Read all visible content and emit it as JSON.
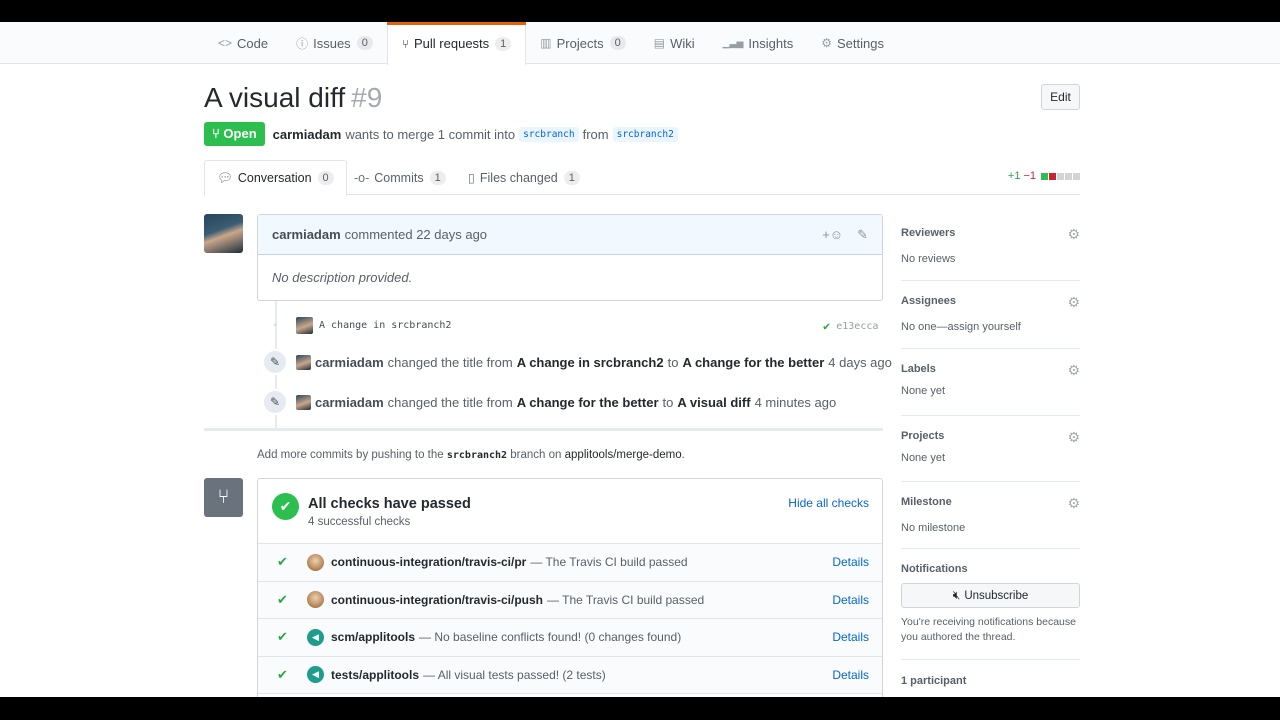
{
  "reponav": [
    {
      "icon": "code-icon",
      "glyph": "<>",
      "label": "Code",
      "count": null
    },
    {
      "icon": "issue-icon",
      "glyph": "ⓘ",
      "label": "Issues",
      "count": "0"
    },
    {
      "icon": "pull-request-icon",
      "glyph": "⑂",
      "label": "Pull requests",
      "count": "1"
    },
    {
      "icon": "project-icon",
      "glyph": "▥",
      "label": "Projects",
      "count": "0"
    },
    {
      "icon": "wiki-icon",
      "glyph": "▤",
      "label": "Wiki",
      "count": null
    },
    {
      "icon": "graph-icon",
      "glyph": "▁▃▅",
      "label": "Insights",
      "count": null
    },
    {
      "icon": "gear-icon",
      "glyph": "⚙",
      "label": "Settings",
      "count": null
    }
  ],
  "pr": {
    "title": "A visual diff",
    "number": "#9",
    "edit_label": "Edit",
    "state": "Open",
    "author": "carmiadam",
    "merge_text": "wants to merge 1 commit into",
    "base_branch": "srcbranch",
    "from_text": "from",
    "head_branch": "srcbranch2"
  },
  "tabs": [
    {
      "label": "Conversation",
      "count": "0"
    },
    {
      "label": "Commits",
      "count": "1"
    },
    {
      "label": "Files changed",
      "count": "1"
    }
  ],
  "diffstat": {
    "additions": "+1",
    "deletions": "−1"
  },
  "comment": {
    "author": "carmiadam",
    "action": "commented",
    "time": "22 days ago",
    "body": "No description provided."
  },
  "commit": {
    "message": "A change in srcbranch2",
    "sha": "e13ecca"
  },
  "events": [
    {
      "author": "carmiadam",
      "text": "changed the title from",
      "from": "A change in srcbranch2",
      "to_text": "to",
      "to": "A change for the better",
      "time": "4 days ago"
    },
    {
      "author": "carmiadam",
      "text": "changed the title from",
      "from": "A change for the better",
      "to_text": "to",
      "to": "A visual diff",
      "time": "4 minutes ago"
    }
  ],
  "push_note": {
    "prefix": "Add more commits by pushing to the",
    "branch": "srcbranch2",
    "middle": "branch on",
    "repo": "applitools/merge-demo",
    "suffix": "."
  },
  "checks": {
    "title": "All checks have passed",
    "subtitle": "4 successful checks",
    "hide_label": "Hide all checks",
    "rows": [
      {
        "name": "continuous-integration/travis-ci/pr",
        "desc": "— The Travis CI build passed",
        "details": "Details"
      },
      {
        "name": "continuous-integration/travis-ci/push",
        "desc": "— The Travis CI build passed",
        "details": "Details"
      },
      {
        "name": "scm/applitools",
        "desc": "— No baseline conflicts found! (0 changes found)",
        "details": "Details"
      },
      {
        "name": "tests/applitools",
        "desc": "— All visual tests passed! (2 tests)",
        "details": "Details"
      }
    ]
  },
  "sidebar": {
    "reviewers": {
      "label": "Reviewers",
      "value": "No reviews"
    },
    "assignees": {
      "label": "Assignees",
      "value": "No one—assign yourself"
    },
    "labels": {
      "label": "Labels",
      "value": "None yet"
    },
    "projects": {
      "label": "Projects",
      "value": "None yet"
    },
    "milestone": {
      "label": "Milestone",
      "value": "No milestone"
    },
    "notifications": {
      "label": "Notifications",
      "button": "Unsubscribe",
      "note": "You're receiving notifications because you authored the thread."
    },
    "participants": "1 participant"
  },
  "colors": {
    "accent": "#e36209",
    "open_green": "#2cbe4e",
    "link": "#0366d6"
  }
}
